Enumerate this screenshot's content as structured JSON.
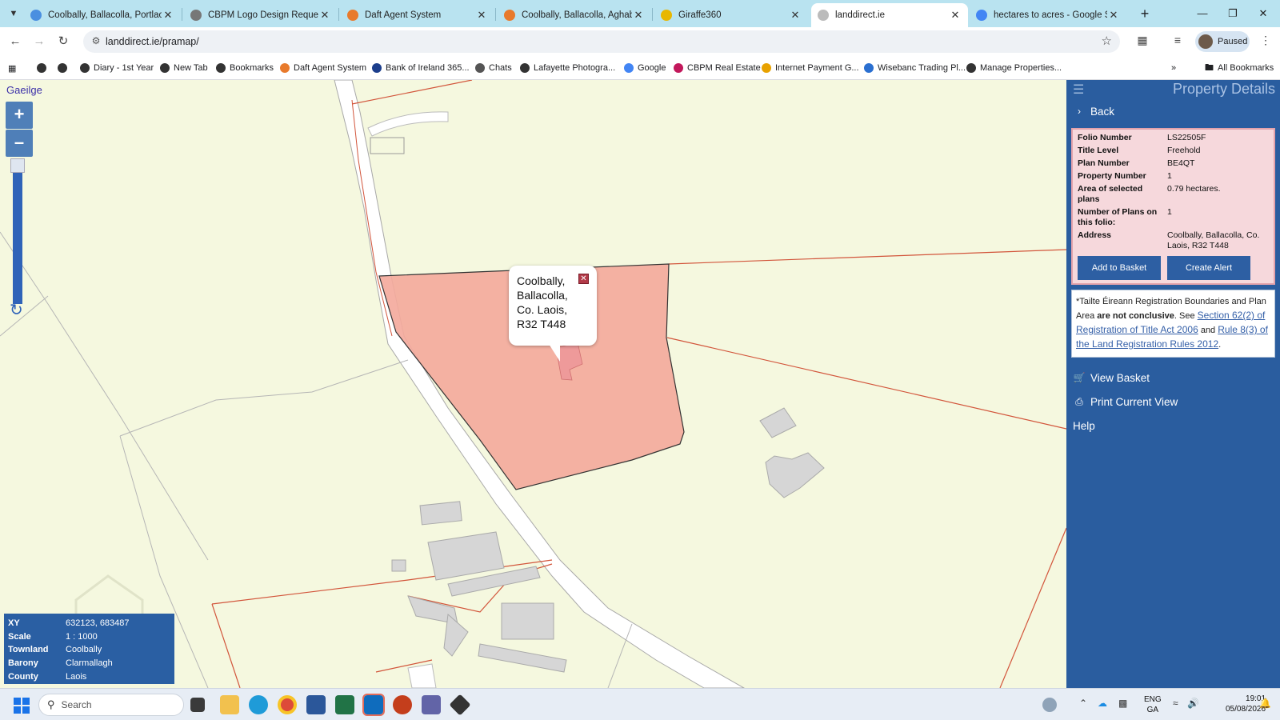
{
  "browser": {
    "tabs": [
      {
        "title": "Coolbally, Ballacolla, Portlaoise",
        "favicon_color": "#4a8fe0",
        "active": false
      },
      {
        "title": "CBPM Logo Design Request",
        "favicon_color": "#777777",
        "active": false
      },
      {
        "title": "Daft Agent System",
        "favicon_color": "#e87a2c",
        "active": false
      },
      {
        "title": "Coolbally, Ballacolla, Aghaboe",
        "favicon_color": "#e87a2c",
        "active": false
      },
      {
        "title": "Giraffe360",
        "favicon_color": "#e8b700",
        "active": false
      },
      {
        "title": "landdirect.ie",
        "favicon_color": "#bbbbbb",
        "active": true
      },
      {
        "title": "hectares to acres - Google Sear",
        "favicon_color": "#4285f4",
        "active": false
      }
    ],
    "url": "landdirect.ie/pramap/",
    "profile_label": "Paused",
    "bookmarks": [
      {
        "label": "",
        "color": "#333"
      },
      {
        "label": "",
        "color": "#333"
      },
      {
        "label": "Diary - 1st Year",
        "color": "#333"
      },
      {
        "label": "New Tab",
        "color": "#333"
      },
      {
        "label": "Bookmarks",
        "color": "#333"
      },
      {
        "label": "Daft Agent System",
        "color": "#e87a2c"
      },
      {
        "label": "Bank of Ireland 365...",
        "color": "#1c3e8c"
      },
      {
        "label": "Chats",
        "color": "#555"
      },
      {
        "label": "Lafayette Photogra...",
        "color": "#333"
      },
      {
        "label": "Google",
        "color": "#4285f4"
      },
      {
        "label": "CBPM Real Estate",
        "color": "#c2185b"
      },
      {
        "label": "Internet Payment G...",
        "color": "#e8a200"
      },
      {
        "label": "Wisebanc Trading Pl...",
        "color": "#2a6fd0"
      },
      {
        "label": "Manage Properties...",
        "color": "#333"
      }
    ],
    "all_bookmarks_label": "All Bookmarks"
  },
  "map": {
    "language_link": "Gaeilge",
    "popup": {
      "line1": "Coolbally,",
      "line2": "Ballacolla,",
      "line3": "Co. Laois,",
      "line4": "R32 T448"
    },
    "info": [
      {
        "key": "XY",
        "value": "632123, 683487"
      },
      {
        "key": "Scale",
        "value": "1 : 1000"
      },
      {
        "key": "Townland",
        "value": "Coolbally"
      },
      {
        "key": "Barony",
        "value": "Clarmallagh"
      },
      {
        "key": "County",
        "value": "Laois"
      }
    ]
  },
  "panel": {
    "title": "Property Details",
    "back_label": "Back",
    "details": [
      {
        "key": "Folio Number",
        "value": "LS22505F"
      },
      {
        "key": "Title Level",
        "value": "Freehold"
      },
      {
        "key": "Plan Number",
        "value": "BE4QT"
      },
      {
        "key": "Property Number",
        "value": "1"
      },
      {
        "key": "Area of selected plans",
        "value": "0.79 hectares."
      },
      {
        "key": "Number of Plans on this folio:",
        "value": "1"
      },
      {
        "key": "Address",
        "value": "Coolbally, Ballacolla, Co. Laois, R32 T448"
      }
    ],
    "add_to_basket_label": "Add to Basket",
    "create_alert_label": "Create Alert",
    "disclaimer": {
      "prefix": "*Tailte Éireann Registration Boundaries and Plan Area ",
      "bold": "are not conclusive",
      "mid": ". See ",
      "link1": "Section 62(2) of Registration of Title Act 2006",
      "and": " and ",
      "link2": "Rule 8(3) of the Land Registration Rules 2012",
      "suffix": "."
    },
    "view_basket_label": "View Basket",
    "print_label": "Print Current View",
    "help_label": "Help"
  },
  "taskbar": {
    "search_placeholder": "Search",
    "lang_line1": "ENG",
    "lang_line2": "GA",
    "time": "19:01",
    "date": "05/08/2026"
  }
}
